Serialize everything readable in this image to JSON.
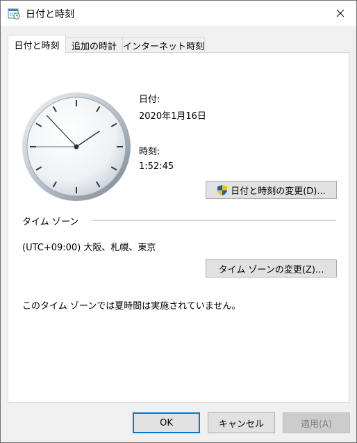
{
  "window": {
    "title": "日付と時刻",
    "icon": "date-time-icon",
    "close_icon": "close-icon"
  },
  "tabs": [
    {
      "label": "日付と時刻",
      "active": true
    },
    {
      "label": "追加の時計",
      "active": false
    },
    {
      "label": "インターネット時刻",
      "active": false
    }
  ],
  "datetime": {
    "date_label": "日付:",
    "date_value": "2020年1月16日",
    "time_label": "時刻:",
    "time_value": "1:52:45",
    "change_button": "日付と時刻の変更(D)...",
    "change_button_icon": "uac-shield-icon"
  },
  "timezone": {
    "group_label": "タイム ゾーン",
    "value": "(UTC+09:00) 大阪、札幌、東京",
    "change_button": "タイム ゾーンの変更(Z)...",
    "dst_note": "このタイム ゾーンでは夏時間は実施されていません。"
  },
  "footer": {
    "ok": "OK",
    "cancel": "キャンセル",
    "apply": "適用(A)"
  },
  "clock": {
    "hours": 1,
    "minutes": 52,
    "seconds": 45
  }
}
